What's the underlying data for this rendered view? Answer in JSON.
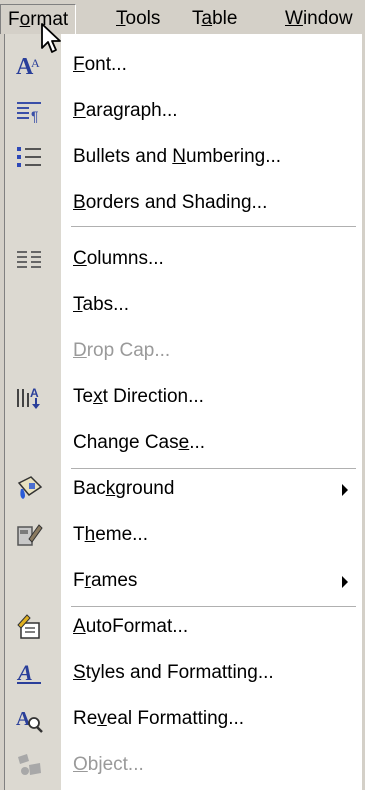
{
  "menubar": {
    "items": [
      {
        "pre": "F",
        "key": "o",
        "post": "rmat"
      },
      {
        "pre": "",
        "key": "T",
        "post": "ools"
      },
      {
        "pre": "T",
        "key": "a",
        "post": "ble"
      },
      {
        "pre": "",
        "key": "W",
        "post": "indow"
      }
    ]
  },
  "menu": {
    "items": [
      {
        "pre": "",
        "key": "F",
        "post": "ont...",
        "icon": "font-icon"
      },
      {
        "pre": "",
        "key": "P",
        "post": "aragraph...",
        "icon": "paragraph-icon"
      },
      {
        "pre": "Bullets and ",
        "key": "N",
        "post": "umbering...",
        "icon": "bullets-icon"
      },
      {
        "pre": "",
        "key": "B",
        "post": "orders and Shading...",
        "icon": ""
      },
      {
        "pre": "",
        "key": "C",
        "post": "olumns...",
        "icon": "columns-icon"
      },
      {
        "pre": "",
        "key": "T",
        "post": "abs...",
        "icon": ""
      },
      {
        "pre": "",
        "key": "D",
        "post": "rop Cap...",
        "icon": "",
        "disabled": true
      },
      {
        "pre": "Te",
        "key": "x",
        "post": "t Direction...",
        "icon": "text-direction-icon"
      },
      {
        "pre": "Change Cas",
        "key": "e",
        "post": "...",
        "icon": ""
      },
      {
        "pre": "Bac",
        "key": "k",
        "post": "ground",
        "icon": "background-icon",
        "submenu": true
      },
      {
        "pre": "T",
        "key": "h",
        "post": "eme...",
        "icon": "theme-icon"
      },
      {
        "pre": "F",
        "key": "r",
        "post": "ames",
        "icon": "",
        "submenu": true
      },
      {
        "pre": "",
        "key": "A",
        "post": "utoFormat...",
        "icon": "autoformat-icon"
      },
      {
        "pre": "",
        "key": "S",
        "post": "tyles and Formatting...",
        "icon": "styles-icon"
      },
      {
        "pre": "Re",
        "key": "v",
        "post": "eal Formatting...",
        "icon": "reveal-formatting-icon"
      },
      {
        "pre": "",
        "key": "O",
        "post": "bject...",
        "icon": "object-icon",
        "disabled": true
      }
    ]
  },
  "colors": {
    "menu_bg": "#ffffff",
    "gutter_bg": "#dcd9d1",
    "bar_bg": "#d4d0c8",
    "disabled_text": "#9a9a9a"
  }
}
